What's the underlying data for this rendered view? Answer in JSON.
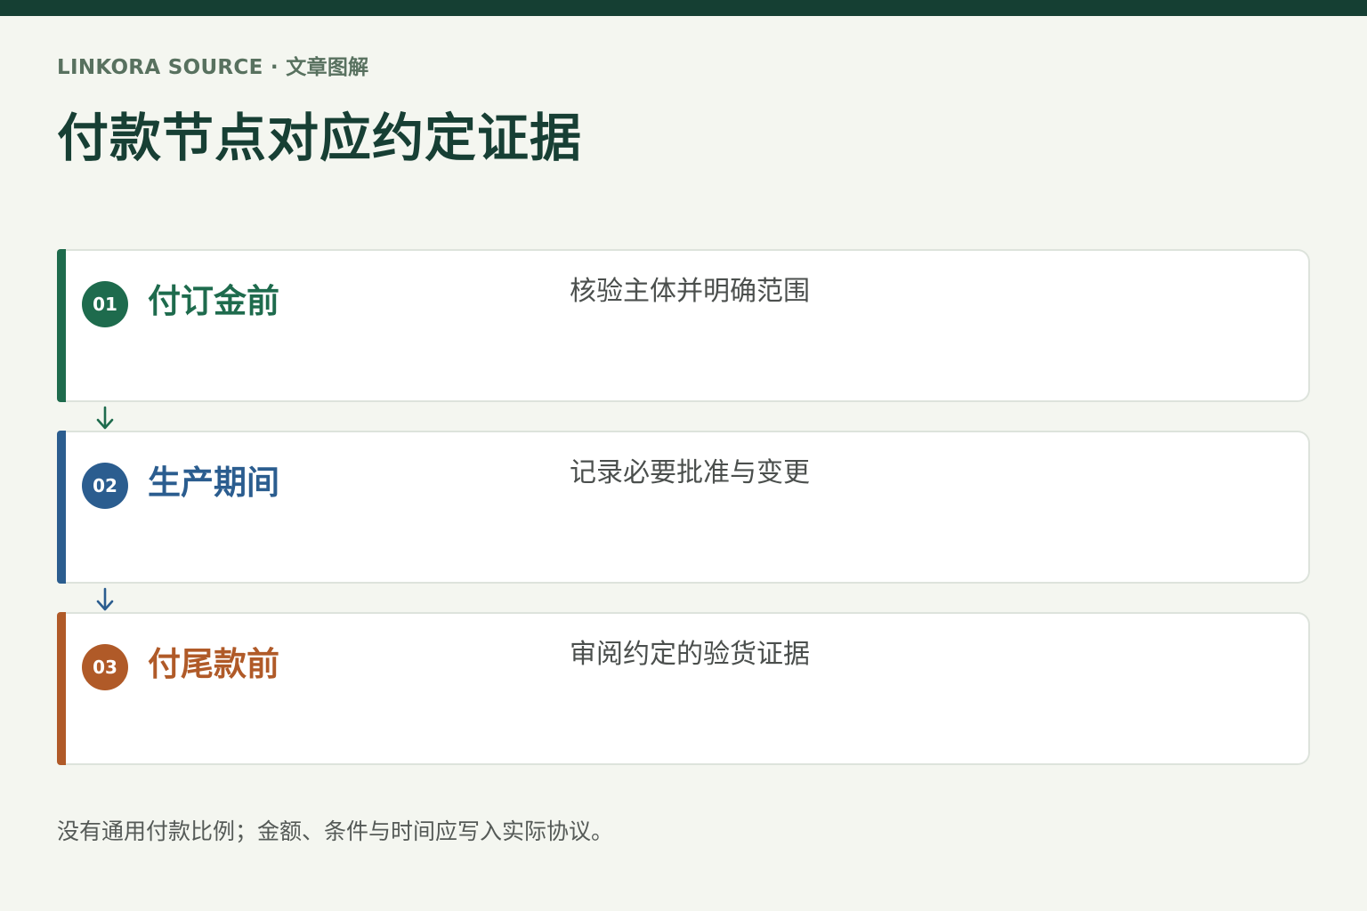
{
  "header": {
    "eyebrow": "LINKORA SOURCE · 文章图解",
    "title": "付款节点对应约定证据"
  },
  "steps": [
    {
      "number": "01",
      "title": "付订金前",
      "description": "核验主体并明确范围",
      "color": "#1e6b4d"
    },
    {
      "number": "02",
      "title": "生产期间",
      "description": "记录必要批准与变更",
      "color": "#2b5d8f"
    },
    {
      "number": "03",
      "title": "付尾款前",
      "description": "审阅约定的验货证据",
      "color": "#b05a28"
    }
  ],
  "connector_icon": "down-arrow-icon",
  "footnote": "没有通用付款比例；金额、条件与时间应写入实际协议。",
  "colors": {
    "top_bar": "#153f33",
    "background": "#f4f6f0",
    "title": "#173f34",
    "eyebrow": "#58715f"
  }
}
